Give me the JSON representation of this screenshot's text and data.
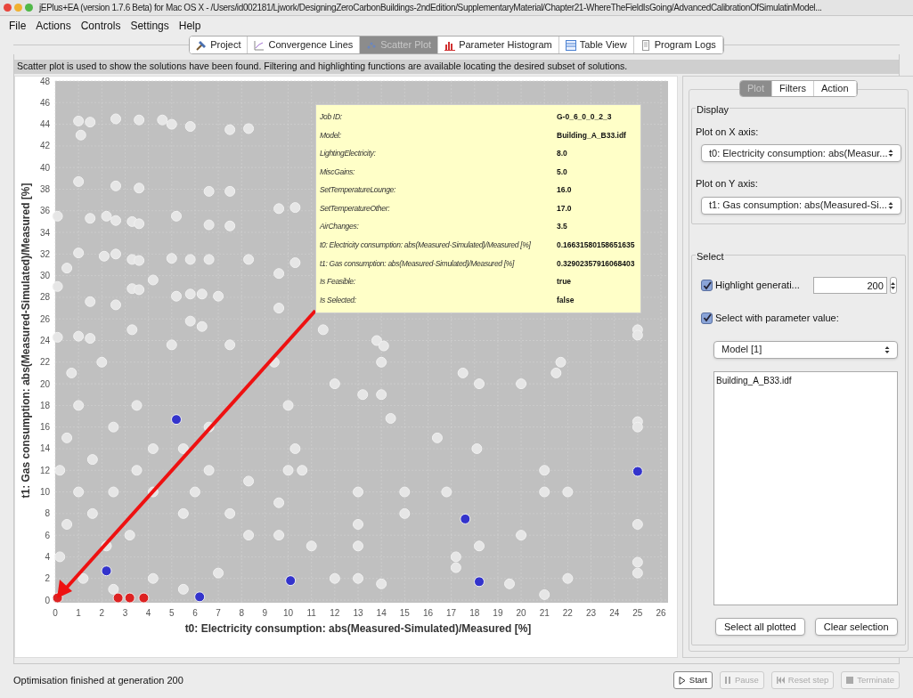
{
  "window": {
    "title": "jEPlus+EA (version 1.7.6 Beta) for Mac OS X - /Users/id002181/Ljwork/DesigningZeroCarbonBuildings-2ndEdition/SupplementaryMaterial/Chapter21-WhereTheFieldIsGoing/AdvancedCalibrationOfSimulatinModel..."
  },
  "menu": [
    "File",
    "Actions",
    "Controls",
    "Settings",
    "Help"
  ],
  "tabs": [
    {
      "label": "Project",
      "kind": "tools",
      "selected": false
    },
    {
      "label": "Convergence Lines",
      "kind": "line",
      "selected": false
    },
    {
      "label": "Scatter Plot",
      "kind": "scatter",
      "selected": true
    },
    {
      "label": "Parameter Histogram",
      "kind": "bars",
      "selected": false
    },
    {
      "label": "Table View",
      "kind": "table",
      "selected": false
    },
    {
      "label": "Program Logs",
      "kind": "doc",
      "selected": false
    }
  ],
  "description": "Scatter plot is used to show the solutions have been found. Filtering and highlighting functions are available locating the desired subset of solutions.",
  "chart": {
    "chart_data": {
      "type": "scatter",
      "grid": true,
      "xlabel": "t0: Electricity consumption: abs(Measured-Simulated)/Measured [%]",
      "ylabel": "t1: Gas consumption: abs(Measured-Simulated)/Measured [%]",
      "xlim": [
        0,
        26
      ],
      "ylim": [
        0,
        48
      ],
      "xticks": [
        0,
        1,
        2,
        3,
        4,
        5,
        6,
        7,
        8,
        9,
        10,
        11,
        12,
        13,
        14,
        15,
        16,
        17,
        18,
        19,
        20,
        21,
        22,
        23,
        24,
        25,
        26
      ],
      "yticks": [
        0,
        2,
        4,
        6,
        8,
        10,
        12,
        14,
        16,
        18,
        20,
        22,
        24,
        26,
        28,
        30,
        32,
        34,
        36,
        38,
        40,
        42,
        44,
        46,
        48
      ],
      "series": [
        {
          "color": "#e6e6e6",
          "x": [
            1,
            1.5,
            1.1,
            2.6,
            3.6,
            4.6,
            5,
            5.8,
            7.5,
            8.3,
            1,
            2.6,
            3.6,
            6.6,
            7.5,
            0.1,
            1.5,
            2.2,
            2.6,
            3.3,
            3.6,
            5.2,
            6.6,
            7.5,
            9.6,
            10.3,
            0.5,
            0.1,
            1,
            2.1,
            2.6,
            3.3,
            3.6,
            4.2,
            5,
            5.8,
            6.6,
            8.3,
            9.6,
            10.3,
            1.5,
            2.6,
            3.3,
            3.6,
            5.2,
            5.8,
            6.3,
            7,
            9.6,
            1,
            0.1,
            1.5,
            3.3,
            5,
            7.5,
            5.8,
            6.3,
            14,
            14,
            13.2,
            13.8,
            14.1,
            17.5,
            21.5,
            21.7,
            18.2,
            18.1,
            21,
            21,
            22,
            25,
            25,
            25,
            25,
            25,
            25,
            25,
            18.2,
            17.2,
            17.2,
            15,
            15,
            13,
            13,
            13,
            12,
            13,
            14,
            11,
            10,
            10,
            10.6,
            9.6,
            9.6,
            8.3,
            8.3,
            7.5,
            7,
            6.6,
            6.6,
            6,
            5.5,
            5.5,
            4.2,
            4.2,
            3.5,
            3.5,
            3.2,
            2.5,
            2.5,
            2.2,
            1.6,
            1.6,
            1,
            1,
            0.5,
            0.5,
            0.2,
            0.2,
            1.2,
            2.5,
            4.2,
            5.5,
            19.5,
            21,
            22,
            16.4,
            16.8,
            20,
            20,
            11.5,
            12,
            14.4,
            10.3,
            9.4,
            0.7,
            2
          ],
          "values": [
            44.3,
            44.2,
            43,
            44.5,
            44.4,
            44.4,
            44,
            43.8,
            43.5,
            43.6,
            38.7,
            38.3,
            38.1,
            37.8,
            37.8,
            35.5,
            35.3,
            35.5,
            35.1,
            35,
            34.8,
            35.5,
            34.7,
            34.6,
            36.2,
            36.3,
            30.7,
            29,
            32.1,
            31.8,
            32,
            31.5,
            31.4,
            29.6,
            31.6,
            31.5,
            31.5,
            31.5,
            30.2,
            31.2,
            27.6,
            27.3,
            28.8,
            28.7,
            28.1,
            28.3,
            28.3,
            28.1,
            27,
            24.4,
            24.3,
            24.2,
            25,
            23.6,
            23.6,
            25.8,
            25.3,
            22,
            19,
            19,
            24,
            23.5,
            21,
            21,
            22,
            20,
            14,
            12,
            10,
            10,
            25,
            24.5,
            16.5,
            16,
            7,
            3.5,
            2.5,
            5,
            4,
            3,
            8,
            10,
            10,
            7,
            5,
            2,
            2,
            1.5,
            5,
            18,
            12,
            12,
            9,
            6,
            11,
            6,
            8,
            2.5,
            16,
            12,
            10,
            14,
            8,
            14,
            10,
            18,
            12,
            6,
            16,
            10,
            5,
            13,
            8,
            18,
            10,
            15,
            7,
            12,
            4,
            2,
            1,
            2,
            1,
            1.5,
            0.5,
            2,
            15,
            10,
            6,
            20,
            25,
            20,
            16.8,
            14,
            22,
            21,
            22
          ]
        },
        {
          "color": "#3333cc",
          "x": [
            5.2,
            2.2,
            10.1,
            17.6,
            18.2,
            25,
            6.2
          ],
          "values": [
            16.7,
            2.7,
            1.8,
            7.5,
            1.7,
            11.9,
            0.3
          ]
        },
        {
          "color": "#dd2222",
          "x": [
            0.1,
            2.7,
            3.2,
            3.8
          ],
          "values": [
            0.2,
            0.2,
            0.2,
            0.2
          ]
        }
      ]
    },
    "tooltip": [
      {
        "label": "Job ID:",
        "value": "G-0_6_0_0_2_3"
      },
      {
        "label": "Model:",
        "value": "Building_A_B33.idf"
      },
      {
        "label": "LightingElectricity:",
        "value": "8.0"
      },
      {
        "label": "MiscGains:",
        "value": "5.0"
      },
      {
        "label": "SetTemperatureLounge:",
        "value": "16.0"
      },
      {
        "label": "SetTemperatureOther:",
        "value": "17.0"
      },
      {
        "label": "AirChanges:",
        "value": "3.5"
      },
      {
        "label": "t0: Electricity consumption: abs(Measured-Simulated)/Measured [%]",
        "value": "0.16631580158651635"
      },
      {
        "label": "t1: Gas consumption: abs(Measured-Simulated)/Measured [%]",
        "value": "0.32902357916068403"
      },
      {
        "label": "Is Feasible:",
        "value": "true"
      },
      {
        "label": "Is Selected:",
        "value": "false"
      }
    ]
  },
  "side_tabs": [
    {
      "label": "Plot",
      "selected": true
    },
    {
      "label": "Filters",
      "selected": false
    },
    {
      "label": "Action",
      "selected": false
    }
  ],
  "display": {
    "title": "Display",
    "x_label": "Plot on X axis:",
    "x_value": "t0: Electricity consumption: abs(Measur...",
    "y_label": "Plot on Y axis:",
    "y_value": "t1: Gas consumption: abs(Measured-Si..."
  },
  "select": {
    "title": "Select",
    "highlight": {
      "label": "Highlight generati...",
      "checked": true,
      "value": "200"
    },
    "by_parameter": {
      "label": "Select with parameter value:",
      "checked": true
    },
    "parameter": "Model [1]",
    "values": [
      "Building_A_B33.idf"
    ],
    "buttons": [
      "Select all plotted",
      "Clear selection"
    ]
  },
  "status": "Optimisation finished at generation 200",
  "controls": [
    {
      "label": "Start",
      "kind": "play",
      "disabled": false
    },
    {
      "label": "Pause",
      "kind": "pause",
      "disabled": true
    },
    {
      "label": "Reset step",
      "kind": "reset",
      "disabled": true
    },
    {
      "label": "Terminate",
      "kind": "stop",
      "disabled": true
    }
  ]
}
